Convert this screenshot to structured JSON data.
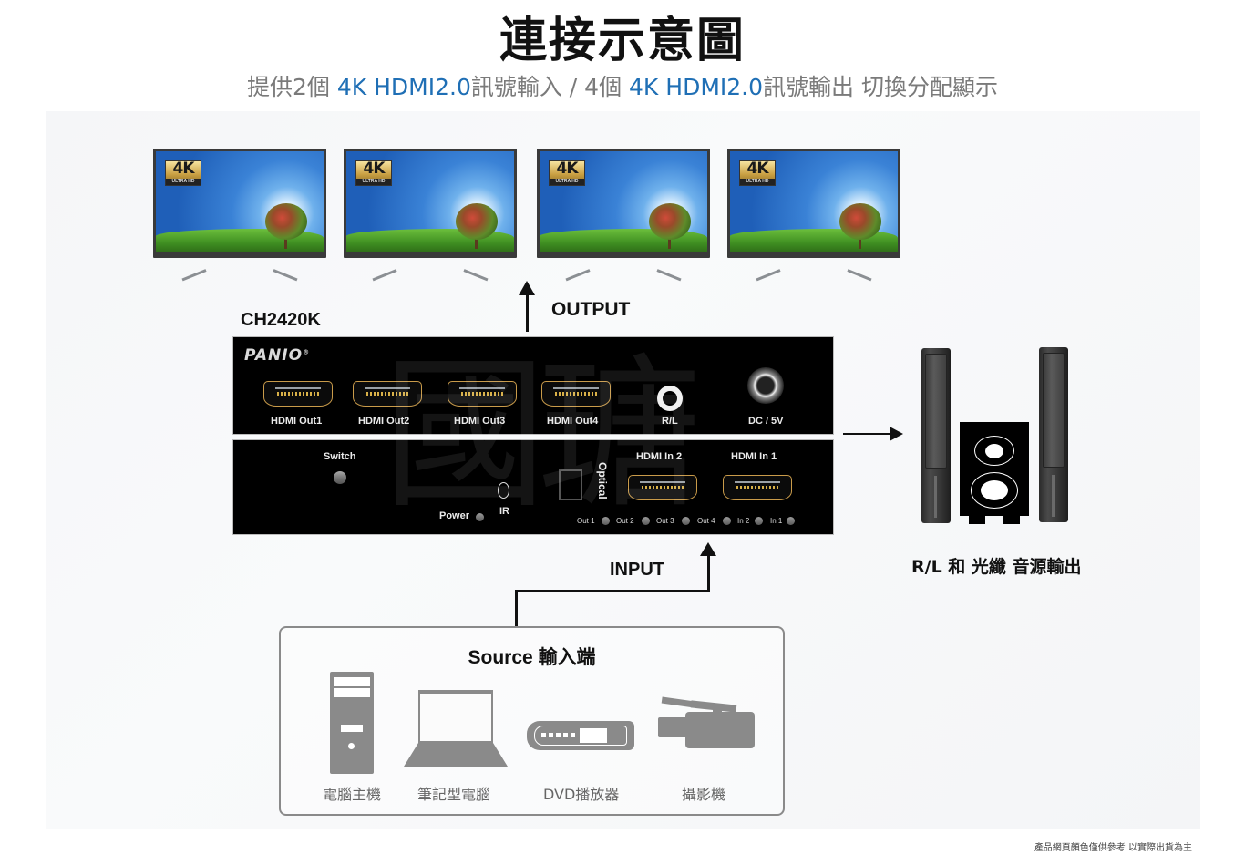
{
  "header": {
    "title": "連接示意圖",
    "subtitle_parts": [
      {
        "text": "提供2個 ",
        "highlight": false
      },
      {
        "text": "4K HDMI2.0",
        "highlight": true
      },
      {
        "text": "訊號輸入 / 4個 ",
        "highlight": false
      },
      {
        "text": "4K HDMI2.0",
        "highlight": true
      },
      {
        "text": "訊號輸出 切換分配顯示",
        "highlight": false
      }
    ],
    "highlight_color": "#1f6fb5"
  },
  "displays": {
    "count": 4,
    "badge_main": "4K",
    "badge_sub": "ULTRA HD"
  },
  "device": {
    "model": "CH2420K",
    "brand": "PANIO",
    "front_outputs": [
      "HDMI Out1",
      "HDMI Out2",
      "HDMI Out3",
      "HDMI Out4"
    ],
    "audio_jack_label": "R/L",
    "power_jack_label": "DC / 5V",
    "switch_label": "Switch",
    "power_label": "Power",
    "ir_label": "IR",
    "optical_label": "Optical",
    "inputs": [
      "HDMI In 2",
      "HDMI In 1"
    ],
    "indicator_leds": [
      "Out 1",
      "Out 2",
      "Out 3",
      "Out 4",
      "In 2",
      "In 1"
    ],
    "watermark": "國瑭"
  },
  "flow": {
    "output_label": "OUTPUT",
    "input_label": "INPUT"
  },
  "audio": {
    "caption": "R/L 和 光纖 音源輸出"
  },
  "source": {
    "title": "Source 輸入端",
    "items": [
      {
        "icon": "desktop-tower-icon",
        "label": "電腦主機"
      },
      {
        "icon": "laptop-icon",
        "label": "筆記型電腦"
      },
      {
        "icon": "dvd-player-icon",
        "label": "DVD播放器"
      },
      {
        "icon": "video-camera-icon",
        "label": "攝影機"
      }
    ]
  },
  "footer": {
    "note": "產品網頁顏色僅供參考 以實際出貨為主"
  }
}
